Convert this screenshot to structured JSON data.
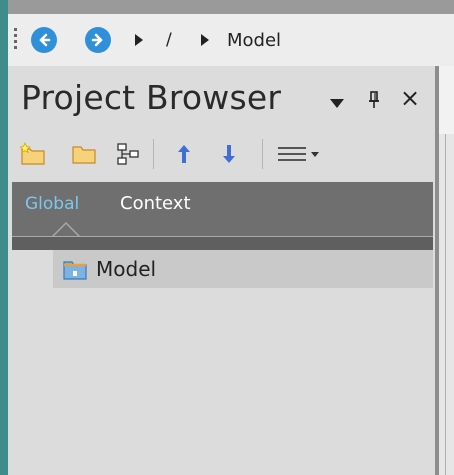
{
  "nav": {
    "back_icon": "arrow-left-circle-icon",
    "forward_icon": "arrow-right-circle-icon",
    "breadcrumb": [
      "/",
      "Model"
    ]
  },
  "panel": {
    "title": "Project Browser",
    "dropdown_icon": "triangle-down-icon",
    "pin_icon": "pin-icon",
    "close_label": "×",
    "toolbar": [
      "new-package-icon",
      "folder-icon",
      "diagram-icon",
      "move-up-icon",
      "move-down-icon",
      "menu-icon"
    ],
    "tabs": {
      "global": "Global",
      "context": "Context"
    },
    "tree": [
      {
        "label": "Model",
        "icon": "package-root-icon"
      }
    ]
  },
  "colors": {
    "accent": "#2f8fd8",
    "frame": "#3f8d8b",
    "tab_active": "#7fc6ee"
  }
}
